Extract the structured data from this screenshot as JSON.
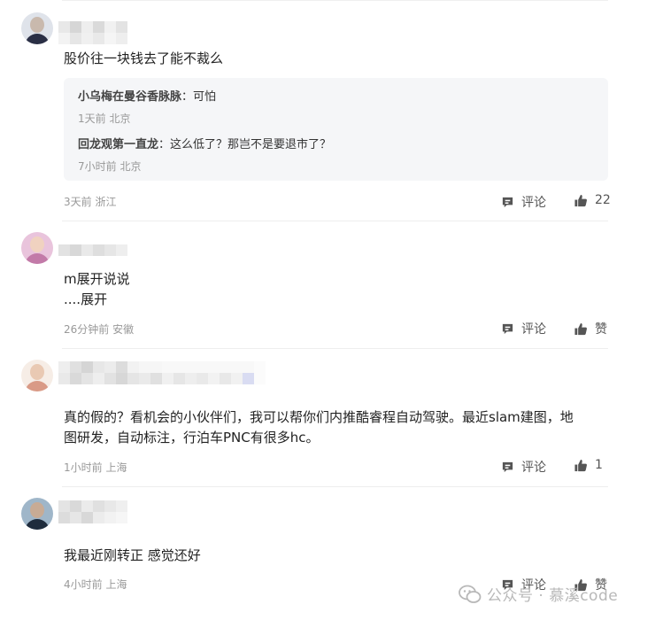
{
  "comments": [
    {
      "text": "股价往一块钱去了能不裁么",
      "meta": "3天前 浙江",
      "reply_label": "评论",
      "like_label": "22",
      "replies": [
        {
          "name": "小乌梅在曼谷香脉脉",
          "sep": "：",
          "text": "可怕",
          "meta": "1天前 北京"
        },
        {
          "name": "回龙观第一直龙",
          "sep": "：",
          "text": "这么低了？那岂不是要退市了？",
          "meta": "7小时前 北京"
        }
      ]
    },
    {
      "text_line1": "m展开说说",
      "text_line2": "....展开",
      "meta": "26分钟前 安徽",
      "reply_label": "评论",
      "like_label": "赞"
    },
    {
      "text_line1": "真的假的？看机会的小伙伴们，我可以帮你们内推酷睿程自动驾驶。最近slam建图，地",
      "text_line2": "图研发，自动标注，行泊车PNC有很多hc。",
      "meta": "1小时前 上海",
      "reply_label": "评论",
      "like_label": "1"
    },
    {
      "text": "我最近刚转正 感觉还好",
      "meta": "4小时前 上海",
      "reply_label": "评论",
      "like_label": "赞"
    }
  ],
  "watermark": {
    "text": "公众号 · 慕溪code",
    "icon": "wechat-icon"
  },
  "icons": {
    "reply": "comment-icon",
    "like": "thumbs-up-icon"
  },
  "colors": {
    "text": "#222222",
    "meta": "#999999",
    "reply_bg": "#f5f6f8",
    "icon": "#555555"
  }
}
